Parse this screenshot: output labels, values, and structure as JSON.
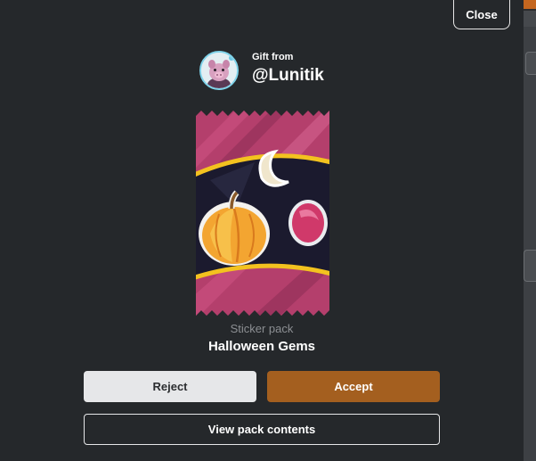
{
  "dialog": {
    "close_label": "Close",
    "gift_from_label": "Gift from",
    "sender_username": "@Lunitik",
    "pack_type_label": "Sticker pack",
    "pack_name": "Halloween Gems",
    "reject_label": "Reject",
    "accept_label": "Accept",
    "view_contents_label": "View pack contents"
  },
  "colors": {
    "modal_bg": "#25282b",
    "accept_bg": "#a45f1f",
    "reject_bg": "#e6e7e9",
    "pack_pink": "#b8406e",
    "pack_gold": "#f0c020"
  },
  "icons": {
    "avatar": "pig-avatar-icon",
    "pack_art": "sticker-pack-image"
  }
}
